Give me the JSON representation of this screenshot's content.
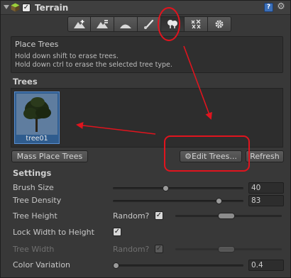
{
  "header": {
    "title": "Terrain",
    "enabled_mark": "✓",
    "help_glyph": "?",
    "settings_glyph": "⚙"
  },
  "toolbar": {
    "tools": [
      {
        "name": "raise-lower",
        "icon": "raise-terrain-icon"
      },
      {
        "name": "paint-height",
        "icon": "paint-height-icon"
      },
      {
        "name": "smooth-height",
        "icon": "smooth-height-icon"
      },
      {
        "name": "paint-texture",
        "icon": "paint-texture-icon"
      },
      {
        "name": "place-trees",
        "icon": "place-trees-icon",
        "active": true
      },
      {
        "name": "paint-details",
        "icon": "paint-details-icon"
      },
      {
        "name": "terrain-settings",
        "icon": "gear-icon"
      }
    ]
  },
  "help": {
    "title": "Place Trees",
    "line1": "Hold down shift to erase trees.",
    "line2": "Hold down ctrl to erase the selected tree type."
  },
  "trees": {
    "heading": "Trees",
    "items": [
      {
        "label": "tree01",
        "selected": true
      }
    ],
    "mass_place_label": "Mass Place Trees",
    "edit_trees_label": "Edit Trees...",
    "edit_icon": "⚙",
    "refresh_label": "Refresh"
  },
  "settings": {
    "heading": "Settings",
    "brush_size": {
      "label": "Brush Size",
      "value": "40",
      "fraction": 0.4
    },
    "tree_density": {
      "label": "Tree Density",
      "value": "83",
      "fraction": 0.83
    },
    "tree_height": {
      "label": "Tree Height",
      "random_label": "Random?",
      "random_checked": true
    },
    "lock_width": {
      "label": "Lock Width to Height",
      "checked": true
    },
    "tree_width": {
      "label": "Tree Width",
      "random_label": "Random?",
      "random_checked": true,
      "disabled": true
    },
    "color_variation": {
      "label": "Color Variation",
      "value": "0.4",
      "fraction": 0.0
    }
  },
  "check_glyph": "✓",
  "colors": {
    "annotation": "#e0141e",
    "selection": "#2f5c8e",
    "panel": "#383838"
  }
}
